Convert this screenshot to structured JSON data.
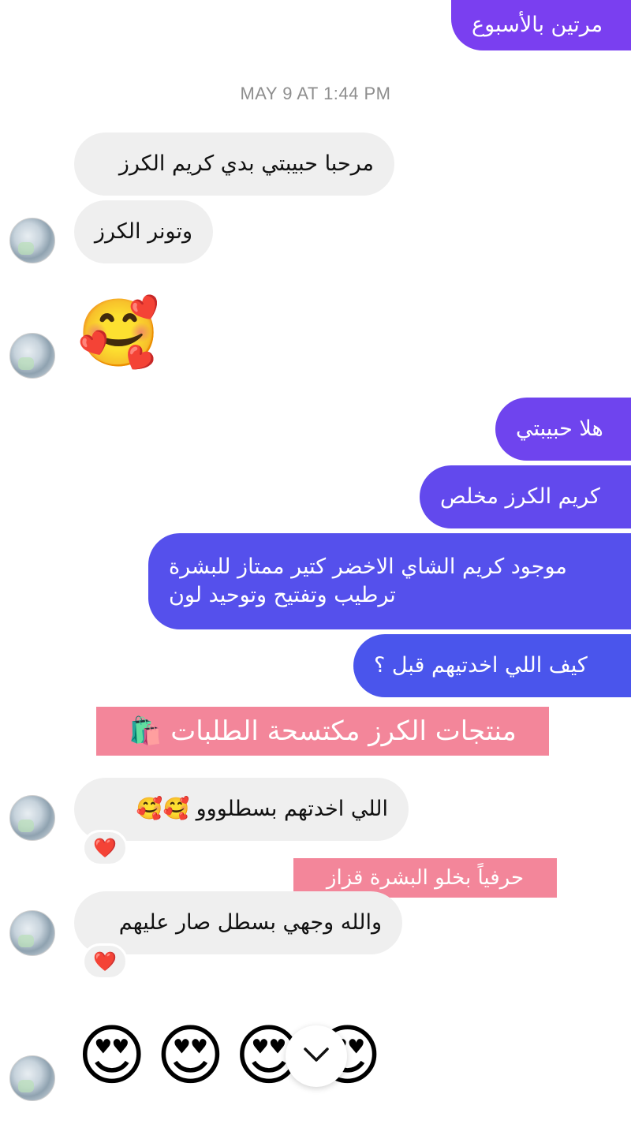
{
  "timestamp": "MAY 9 AT 1:44 PM",
  "outgoing_top": "مرتين بالأسبوع",
  "incoming_1": "مرحبا حبيبتي بدي كريم الكرز",
  "incoming_2": "وتونر الكرز",
  "emoji_smile_hearts": "🥰",
  "outgoing": {
    "m1": "هلا حبيبتي",
    "m2": "كريم الكرز مخلص",
    "m3_line1": "موجود كريم الشاي الاخضر كتير ممتاز للبشرة",
    "m3_line2": "ترطيب وتفتيح وتوحيد لون",
    "m4": "كيف اللي اخدتيهم قبل ؟"
  },
  "caption_1": "منتجات الكرز مكتسحة الطلبات 🛍️",
  "incoming_3": "اللي اخدتهم بسطلووو 🥰🥰",
  "reaction_heart": "❤️",
  "caption_2": "حرفياً بخلو البشرة قزاز",
  "incoming_4": "والله وجهي بسطل صار عليهم",
  "emoji_heart_eyes": "😍",
  "colors": {
    "out_purple": "#7a3ff0",
    "out_blue": "#4a55ec",
    "incoming_bg": "#efefef",
    "caption_bg": "#f3869a"
  },
  "icons": {
    "scroll_down": "chevron-down-icon"
  }
}
